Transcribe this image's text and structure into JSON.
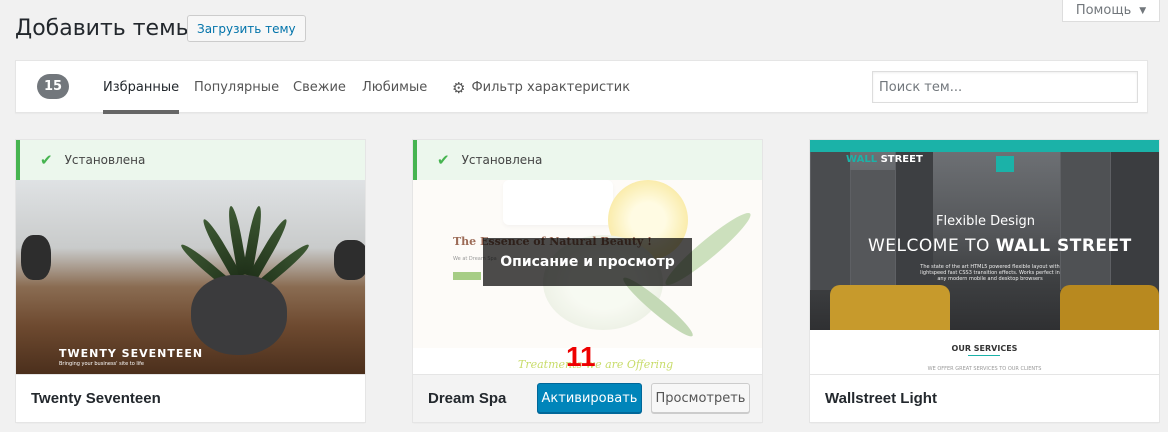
{
  "header": {
    "title": "Добавить темы",
    "upload_label": "Загрузить тему",
    "help_label": "Помощь"
  },
  "filter": {
    "count": "15",
    "tabs": [
      "Избранные",
      "Популярные",
      "Свежие",
      "Любимые"
    ],
    "active_tab": "Избранные",
    "feature_filter_label": "Фильтр характеристик",
    "search_placeholder": "Поиск тем..."
  },
  "themes": [
    {
      "name": "Twenty Seventeen",
      "installed_label": "Установлена",
      "screenshot_title": "TWENTY SEVENTEEN",
      "screenshot_tagline": "Bringing your business' site to life"
    },
    {
      "name": "Dream Spa",
      "installed_label": "Установлена",
      "overlay_label": "Описание и просмотр",
      "activate_label": "Активировать",
      "preview_label": "Просмотреть",
      "screenshot_heading": "The Essence of Natural Beauty !",
      "screenshot_sub": "We at Dream Spa",
      "screenshot_script": "Treatments we are Offering"
    },
    {
      "name": "Wallstreet Light",
      "screenshot_logo_a": "WALL",
      "screenshot_logo_b": "STREET",
      "screenshot_flex": "Flexible Design",
      "screenshot_welcome_a": "WELCOME TO",
      "screenshot_welcome_b": "WALL STREET",
      "screenshot_desc": "The state of the art HTML5 powered flexible layout with lightspeed fast CSS3 transition effects. Works perfect in any modern mobile and desktop browsers",
      "screenshot_services": "OUR SERVICES",
      "screenshot_offer": "WE OFFER GREAT SERVICES TO OUR CLIENTS"
    }
  ],
  "annotation": "11",
  "colors": {
    "accent": "#0085ba",
    "installed_green": "#46b450",
    "wallstreet_teal": "#1bb2a8",
    "annotation_red": "#ee0000"
  }
}
